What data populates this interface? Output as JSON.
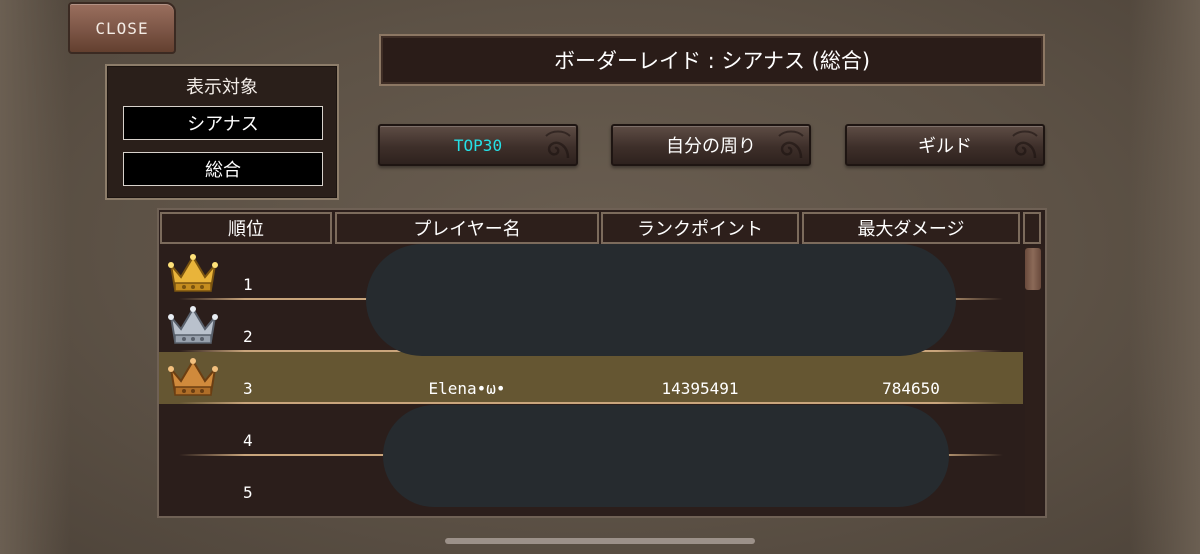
{
  "close_label": "CLOSE",
  "target_panel": {
    "title": "表示対象",
    "options": [
      "シアナス",
      "総合"
    ]
  },
  "title": "ボーダーレイド : シアナス (総合)",
  "tabs": [
    {
      "label": "TOP30",
      "active": true
    },
    {
      "label": "自分の周り",
      "active": false
    },
    {
      "label": "ギルド",
      "active": false
    }
  ],
  "table": {
    "headers": [
      "順位",
      "プレイヤー名",
      "ランクポイント",
      "最大ダメージ"
    ],
    "rows": [
      {
        "rank": "1",
        "crown": "gold-crown-icon",
        "name": "",
        "points": "",
        "damage": ""
      },
      {
        "rank": "2",
        "crown": "silver-crown-icon",
        "name": "",
        "points": "",
        "damage": ""
      },
      {
        "rank": "3",
        "crown": "bronze-crown-icon",
        "name": "Elena•ω•",
        "points": "14395491",
        "damage": "784650",
        "highlighted": true
      },
      {
        "rank": "4",
        "crown": "",
        "name": "",
        "points": "",
        "damage": ""
      },
      {
        "rank": "5",
        "crown": "",
        "name": "",
        "points": "",
        "damage": ""
      }
    ]
  },
  "colors": {
    "active_tab_text": "#25e0e6",
    "highlight_row": "#655632",
    "gold": "#e9b43a",
    "silver": "#b9c1cc",
    "bronze": "#d08a3c"
  }
}
